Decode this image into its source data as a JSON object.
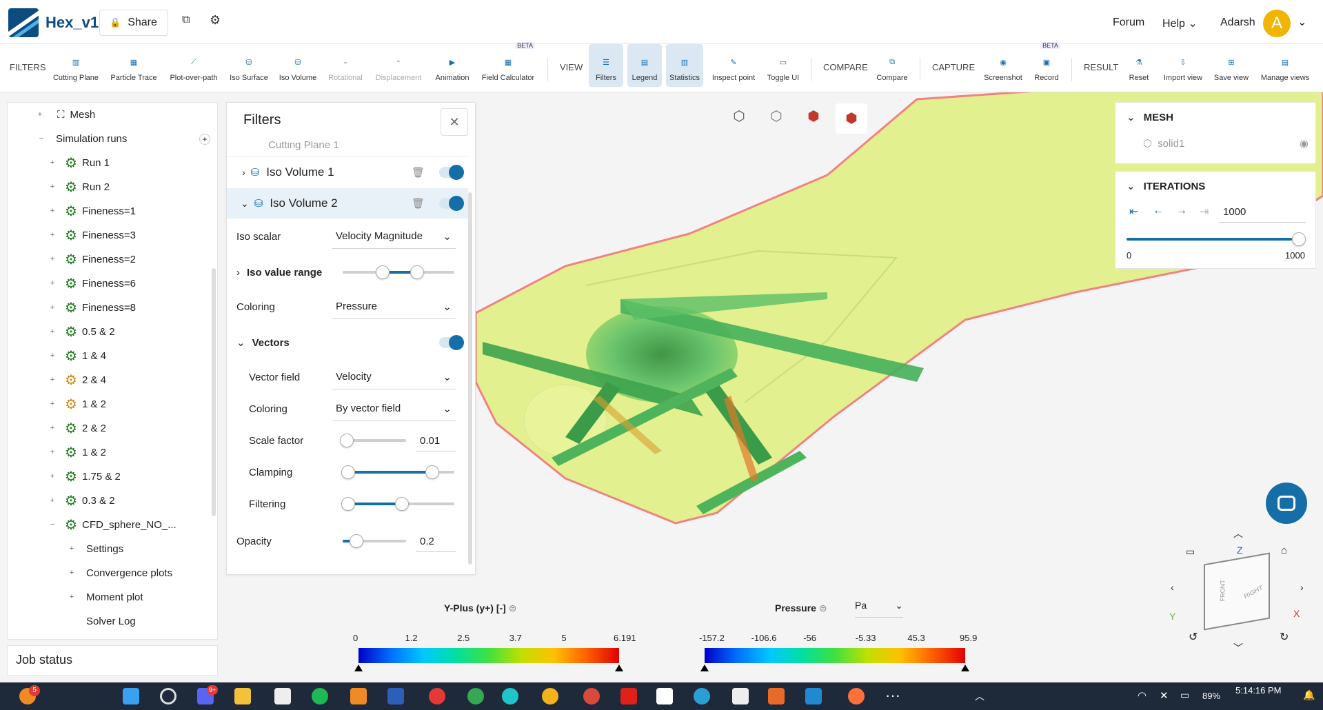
{
  "app": {
    "title": "Hex_v1",
    "share_label": "Share",
    "nav": {
      "forum": "Forum",
      "help": "Help",
      "user": "Adarsh",
      "avatar_letter": "A"
    }
  },
  "toolbar": {
    "groups": {
      "filters": "FILTERS",
      "view": "VIEW",
      "compare": "COMPARE",
      "capture": "CAPTURE",
      "result": "RESULT"
    },
    "items": {
      "cutting_plane": "Cutting Plane",
      "particle_trace": "Particle Trace",
      "plot_over_path": "Plot-over-path",
      "iso_surface": "Iso Surface",
      "iso_volume": "Iso Volume",
      "rotational": "Rotational",
      "displacement": "Displacement",
      "animation": "Animation",
      "field_calculator": "Field Calculator",
      "filters": "Filters",
      "legend": "Legend",
      "statistics": "Statistics",
      "inspect_point": "Inspect point",
      "toggle_ui": "Toggle UI",
      "compare": "Compare",
      "screenshot": "Screenshot",
      "record": "Record",
      "reset": "Reset",
      "import_view": "Import view",
      "save_view": "Save view",
      "manage_views": "Manage views"
    },
    "beta": "BETA"
  },
  "tree": {
    "mesh": "Mesh",
    "simulation_runs": "Simulation runs",
    "runs": [
      {
        "label": "Run 1",
        "status": "green"
      },
      {
        "label": "Run 2",
        "status": "green"
      },
      {
        "label": "Fineness=1",
        "status": "green"
      },
      {
        "label": "Fineness=3",
        "status": "green"
      },
      {
        "label": "Fineness=2",
        "status": "green"
      },
      {
        "label": "Fineness=6",
        "status": "green"
      },
      {
        "label": "Fineness=8",
        "status": "green"
      },
      {
        "label": "0.5 & 2",
        "status": "green"
      },
      {
        "label": "1 & 4",
        "status": "green"
      },
      {
        "label": "2 & 4",
        "status": "orange"
      },
      {
        "label": "1 & 2",
        "status": "orange"
      },
      {
        "label": "2 & 2",
        "status": "green"
      },
      {
        "label": "1 & 2",
        "status": "green"
      },
      {
        "label": "1.75 & 2",
        "status": "green"
      },
      {
        "label": "0.3 & 2",
        "status": "green"
      },
      {
        "label": "CFD_sphere_NO_...",
        "status": "green"
      }
    ],
    "children": [
      "Settings",
      "Convergence plots",
      "Moment plot",
      "Solver Log"
    ],
    "job_status": "Job status"
  },
  "filters_panel": {
    "title": "Filters",
    "cut_item": "Cutting Plane 1",
    "iso1": "Iso Volume 1",
    "iso2": "Iso Volume 2",
    "iso_scalar_label": "Iso scalar",
    "iso_scalar_value": "Velocity Magnitude",
    "iso_range_label": "Iso value range",
    "coloring_label": "Coloring",
    "coloring_value": "Pressure",
    "vectors_label": "Vectors",
    "vector_field_label": "Vector field",
    "vector_field_value": "Velocity",
    "vcoloring_label": "Coloring",
    "vcoloring_value": "By vector field",
    "scale_label": "Scale factor",
    "scale_value": "0.01",
    "clamping_label": "Clamping",
    "filtering_label": "Filtering",
    "opacity_label": "Opacity",
    "opacity_value": "0.2"
  },
  "mesh_panel": {
    "title": "MESH",
    "solid": "solid1"
  },
  "iterations_panel": {
    "title": "ITERATIONS",
    "value": "1000",
    "min": "0",
    "max": "1000"
  },
  "legend_yplus": {
    "title": "Y-Plus (y+) [-]",
    "ticks": [
      "0",
      "1.2",
      "2.5",
      "3.7",
      "5",
      "6.191"
    ]
  },
  "legend_pressure": {
    "title": "Pressure",
    "unit": "Pa",
    "ticks": [
      "-157.2",
      "-106.6",
      "-56",
      "-5.33",
      "45.3",
      "95.9"
    ]
  },
  "cube_labels": {
    "z": "Z",
    "y": "Y",
    "x": "X",
    "front": "FRONT",
    "right": "RIGHT"
  },
  "taskbar": {
    "time": "5:14:16 PM",
    "battery": "89%",
    "badge_left": "5",
    "badge_discord": "9+"
  }
}
